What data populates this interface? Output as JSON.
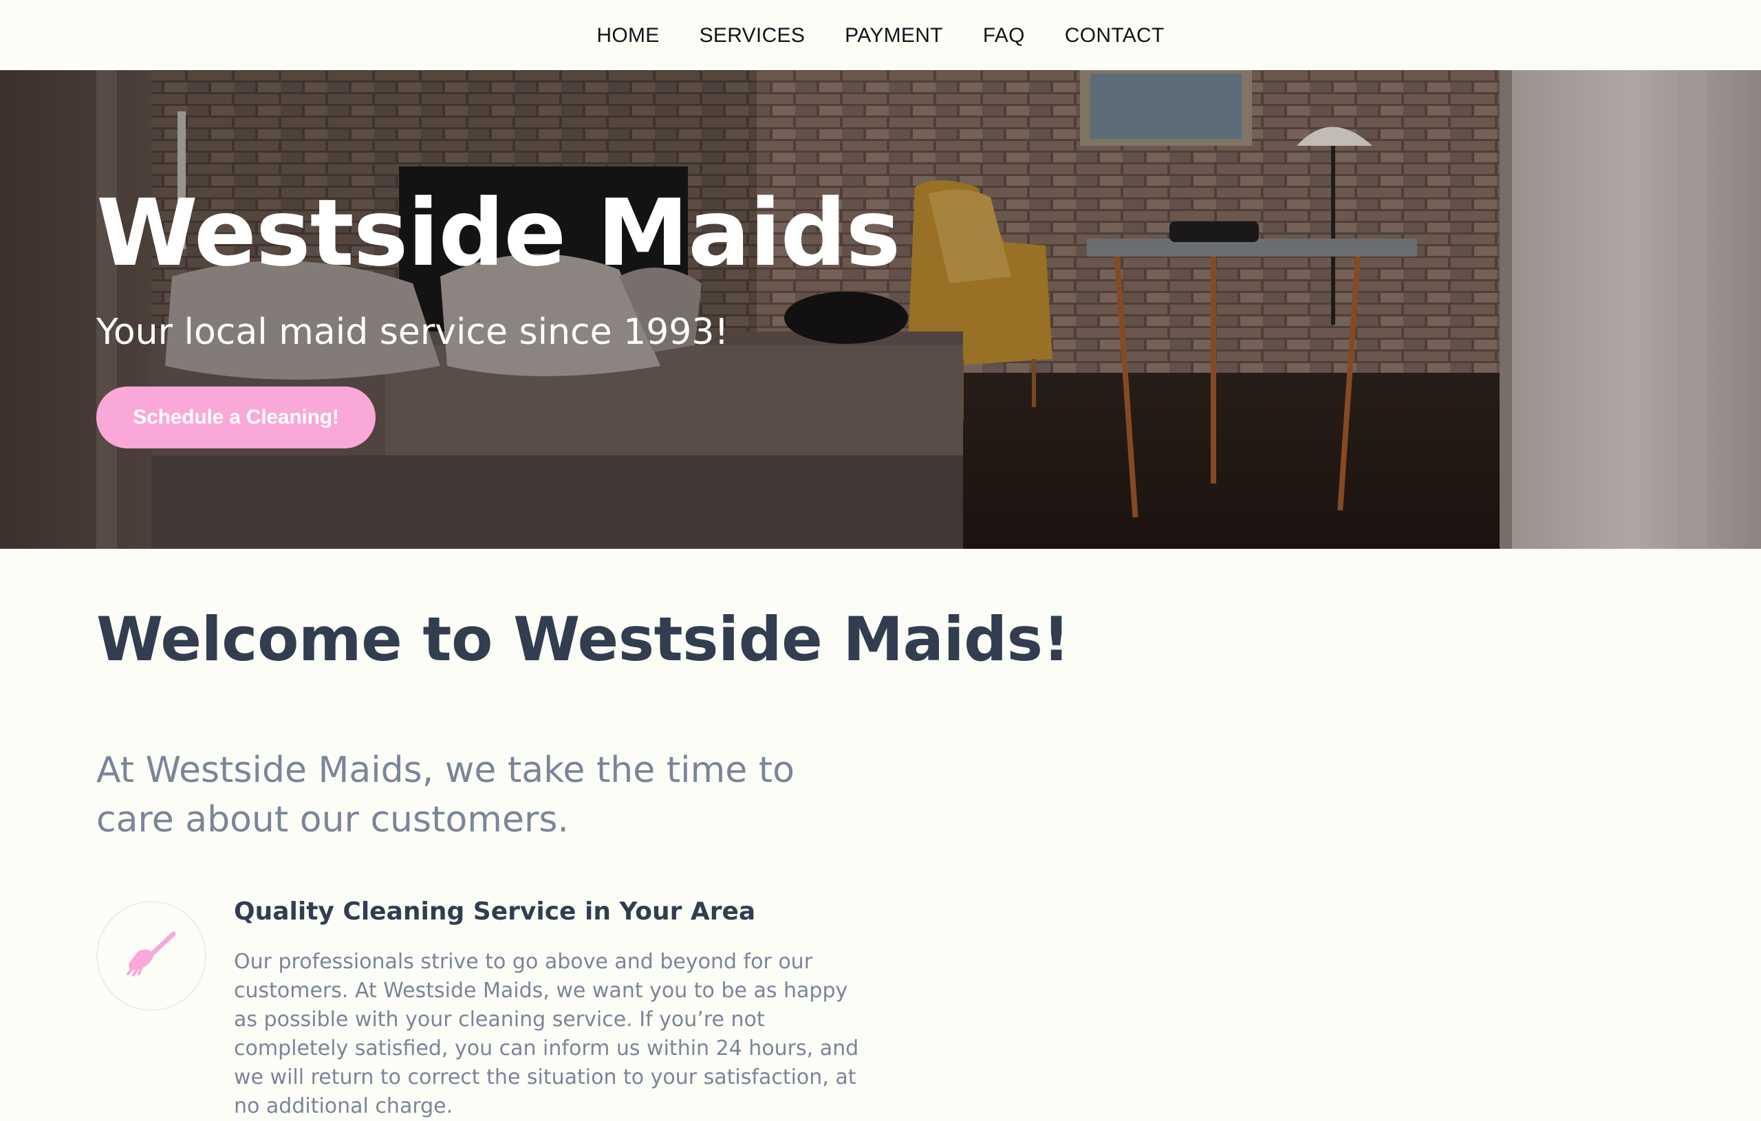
{
  "nav": {
    "items": [
      {
        "label": "HOME"
      },
      {
        "label": "SERVICES"
      },
      {
        "label": "PAYMENT"
      },
      {
        "label": "FAQ"
      },
      {
        "label": "CONTACT"
      }
    ]
  },
  "hero": {
    "title": "Westside Maids",
    "subtitle": "Your local maid service since 1993!",
    "cta_label": "Schedule a Cleaning!",
    "background": "living-room-photo"
  },
  "welcome": {
    "title": "Welcome to Westside Maids!",
    "lead": "At Westside Maids, we take the time to care about our customers."
  },
  "feature": {
    "icon": "broom-icon",
    "title": "Quality Cleaning Service in Your Area",
    "body": "Our professionals strive to go above and beyond for our customers. At Westside Maids, we want you to be as happy as possible with your cleaning service. If you’re not completely satisfied, you can inform us within 24 hours, and we will return to correct the situation to your satisfaction, at no additional charge."
  },
  "colors": {
    "accent": "#f9a8d8",
    "heading": "#323d4f",
    "muted": "#7a8598",
    "background": "#fdfdf8"
  }
}
